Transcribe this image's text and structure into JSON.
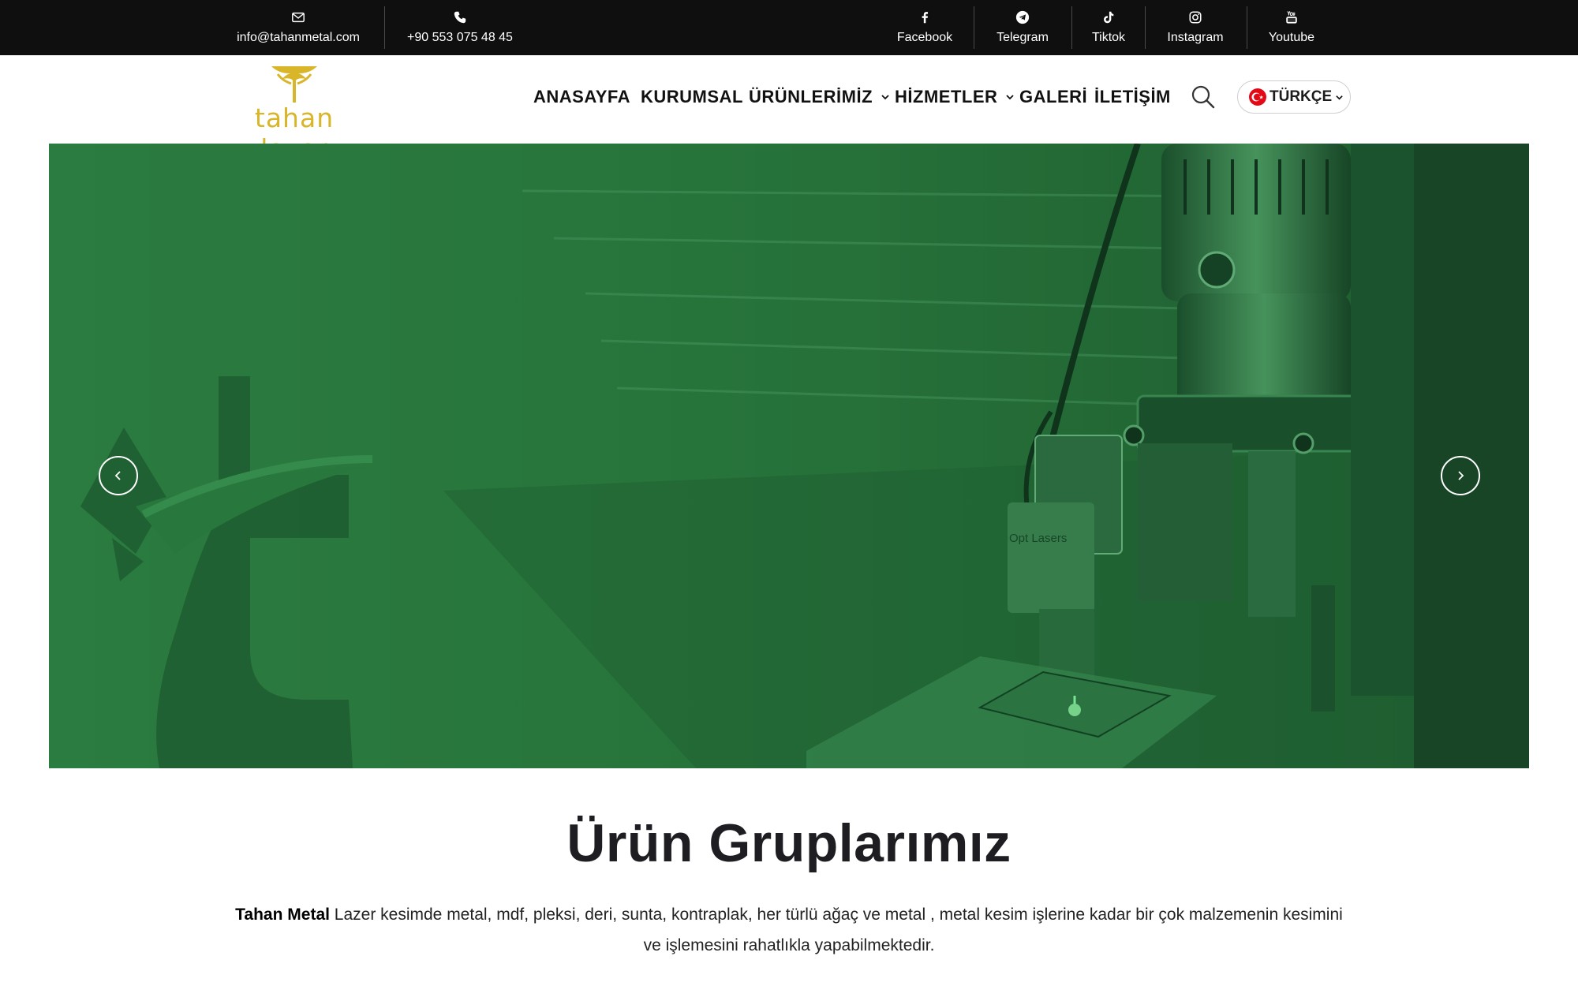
{
  "topbar": {
    "email": "info@tahanmetal.com",
    "phone": "+90 553 075 48 45",
    "socials": [
      {
        "label": "Facebook",
        "icon": "facebook-icon"
      },
      {
        "label": "Telegram",
        "icon": "telegram-icon"
      },
      {
        "label": "Tiktok",
        "icon": "tiktok-icon"
      },
      {
        "label": "Instagram",
        "icon": "instagram-icon"
      },
      {
        "label": "Youtube",
        "icon": "youtube-icon"
      }
    ]
  },
  "header": {
    "logo_text": "tahan lazer",
    "nav": [
      {
        "label": "ANASAYFA"
      },
      {
        "label": "KURUMSAL"
      },
      {
        "label": "ÜRÜNLERİMİZ",
        "has_dropdown": true
      },
      {
        "label": "HİZMETLER",
        "has_dropdown": true
      },
      {
        "label": "GALERİ"
      },
      {
        "label": "İLETİŞİM"
      }
    ],
    "language": "TÜRKÇE"
  },
  "hero": {
    "machine_label": "Opt Lasers",
    "overlay_color": "#2b7a3f"
  },
  "products": {
    "title": "Ürün Gruplarımız",
    "brand": "Tahan Metal",
    "description": "Lazer kesimde metal, mdf, pleksi, deri, sunta, kontraplak, her türlü ağaç ve metal , metal kesim işlerine kadar bir çok malzemenin kesimini ve işlemesini rahatlıkla yapabilmektedir."
  },
  "colors": {
    "topbar_bg": "#0f0f10",
    "brand_gold": "#d9b52a",
    "hero_green": "#2b7a3f"
  }
}
